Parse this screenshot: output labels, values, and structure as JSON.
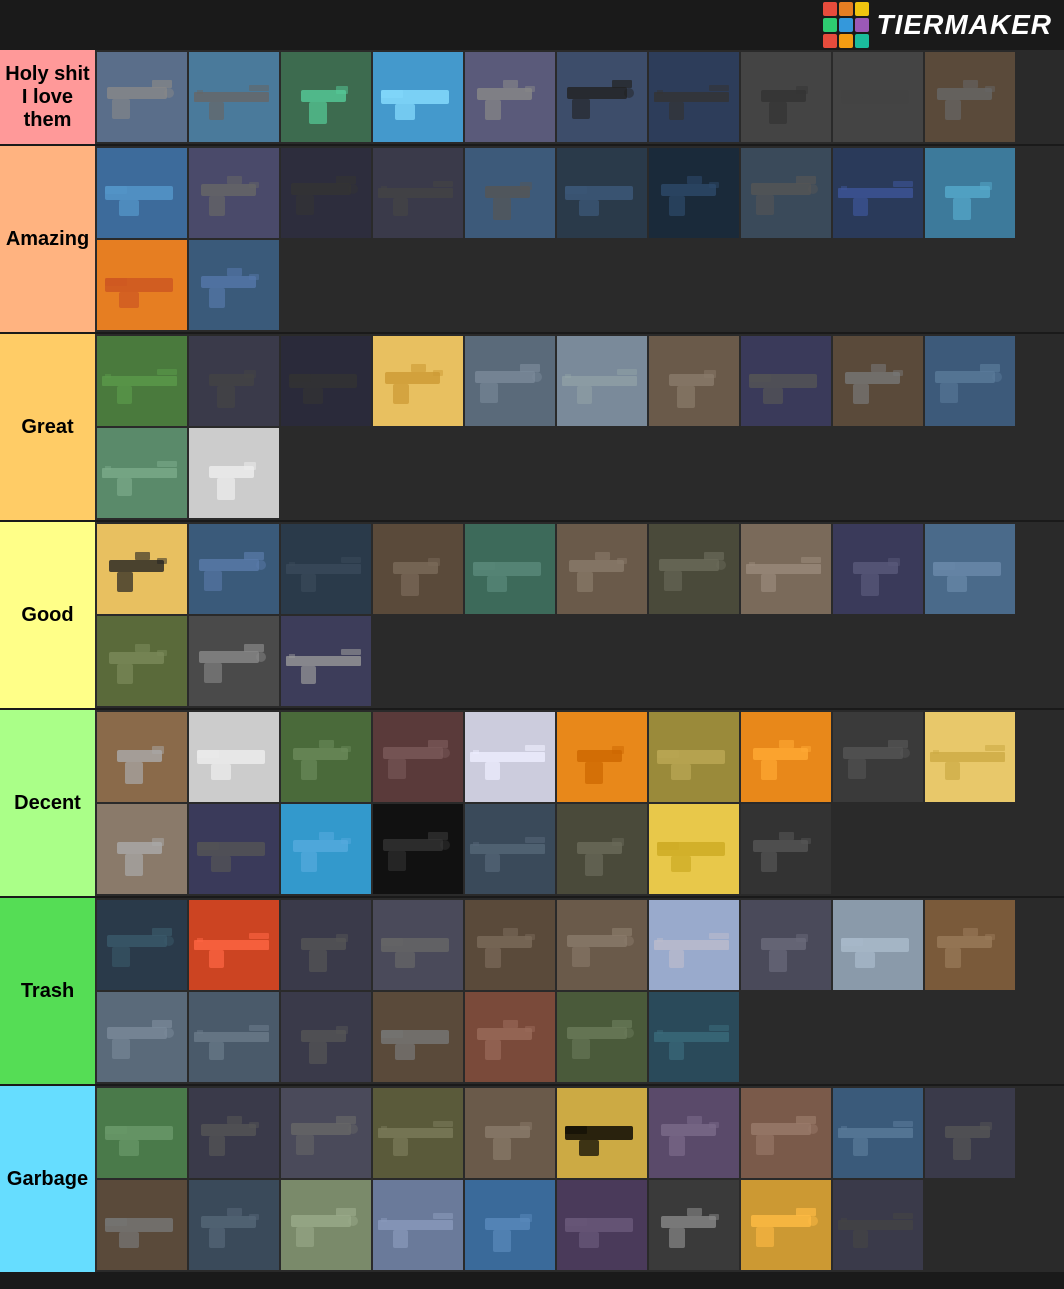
{
  "header": {
    "logo_colors": [
      "#e74c3c",
      "#e67e22",
      "#f1c40f",
      "#2ecc71",
      "#3498db",
      "#9b59b6",
      "#e74c3c",
      "#f39c12",
      "#1abc9c"
    ],
    "title": "TiERMAKER"
  },
  "tiers": [
    {
      "id": "holy-shit",
      "label": "Holy shit I love them",
      "color": "#ff9999",
      "items": [
        {
          "bg": "#5a6e8a",
          "accent": "#888"
        },
        {
          "bg": "#4a7a9b",
          "accent": "#666"
        },
        {
          "bg": "#3d6b4f",
          "accent": "#5c9"
        },
        {
          "bg": "#4499cc",
          "accent": "#88ddff"
        },
        {
          "bg": "#5a5a7a",
          "accent": "#888"
        },
        {
          "bg": "#3d4d6a",
          "accent": "#222"
        },
        {
          "bg": "#2d3d5a",
          "accent": "#333"
        },
        {
          "bg": "#444",
          "accent": "#333"
        },
        {
          "bg": "#444",
          "accent": "#444"
        },
        {
          "bg": "#5a4a3a",
          "accent": "#666"
        }
      ]
    },
    {
      "id": "amazing",
      "label": "Amazing",
      "color": "#ffb380",
      "items": [
        {
          "bg": "#3d6b9b",
          "accent": "#5599cc"
        },
        {
          "bg": "#4a4a6a",
          "accent": "#666"
        },
        {
          "bg": "#2d2d3d",
          "accent": "#333"
        },
        {
          "bg": "#3a3a4a",
          "accent": "#444"
        },
        {
          "bg": "#3d5a7a",
          "accent": "#555"
        },
        {
          "bg": "#2a3a4a",
          "accent": "#3d5a7a"
        },
        {
          "bg": "#1a2a3a",
          "accent": "#2d4a6a"
        },
        {
          "bg": "#3a4a5a",
          "accent": "#555"
        },
        {
          "bg": "#2a3a5a",
          "accent": "#3d5599"
        },
        {
          "bg": "#3d7a9b",
          "accent": "#55aacc"
        },
        {
          "bg": "#e67e22",
          "accent": "#cc5522"
        },
        {
          "bg": "#3a5a7a",
          "accent": "#5577aa"
        }
      ]
    },
    {
      "id": "great",
      "label": "Great",
      "color": "#ffcc66",
      "items": [
        {
          "bg": "#4a7a3d",
          "accent": "#5a9a4a"
        },
        {
          "bg": "#3a3a4a",
          "accent": "#444"
        },
        {
          "bg": "#2a2a3a",
          "accent": "#333"
        },
        {
          "bg": "#e8c060",
          "accent": "#cc9933"
        },
        {
          "bg": "#5a6a7a",
          "accent": "#7a8a9a"
        },
        {
          "bg": "#7a8a9a",
          "accent": "#9aaa"
        },
        {
          "bg": "#6a5a4a",
          "accent": "#8a7a6a"
        },
        {
          "bg": "#3a3a5a",
          "accent": "#555"
        },
        {
          "bg": "#5a4a3a",
          "accent": "#777"
        },
        {
          "bg": "#3d5a7a",
          "accent": "#5a7a9a"
        },
        {
          "bg": "#5a8a6a",
          "accent": "#7aaa8a"
        },
        {
          "bg": "#cccccc",
          "accent": "#eeeeee"
        }
      ]
    },
    {
      "id": "good",
      "label": "Good",
      "color": "#ffff88",
      "items": [
        {
          "bg": "#e8c060",
          "accent": "#222"
        },
        {
          "bg": "#3a5a7a",
          "accent": "#5a7aaa"
        },
        {
          "bg": "#2a3a4a",
          "accent": "#3a4a5a"
        },
        {
          "bg": "#5a4a3a",
          "accent": "#7a6a5a"
        },
        {
          "bg": "#3d6a5a",
          "accent": "#5a8a7a"
        },
        {
          "bg": "#6a5a4a",
          "accent": "#8a7a6a"
        },
        {
          "bg": "#4a4a3a",
          "accent": "#6a6a5a"
        },
        {
          "bg": "#7a6a5a",
          "accent": "#9a8a7a"
        },
        {
          "bg": "#3a3a5a",
          "accent": "#5a5a7a"
        },
        {
          "bg": "#4a6a8a",
          "accent": "#6a8aaa"
        },
        {
          "bg": "#5a6a3a",
          "accent": "#7a8a5a"
        },
        {
          "bg": "#4a4a4a",
          "accent": "#888"
        },
        {
          "bg": "#3d3d5a",
          "accent": "#999"
        }
      ]
    },
    {
      "id": "decent",
      "label": "Decent",
      "color": "#aaff88",
      "items": [
        {
          "bg": "#8a6a4a",
          "accent": "#aaa"
        },
        {
          "bg": "#cccccc",
          "accent": "#eeeeee"
        },
        {
          "bg": "#4a6a3a",
          "accent": "#6a8a5a"
        },
        {
          "bg": "#5a3a3a",
          "accent": "#7a5a5a"
        },
        {
          "bg": "#ccccdd",
          "accent": "#eeeeff"
        },
        {
          "bg": "#e8881a",
          "accent": "#cc6600"
        },
        {
          "bg": "#9a8a3a",
          "accent": "#bba855"
        },
        {
          "bg": "#e8881a",
          "accent": "#ffaa33"
        },
        {
          "bg": "#3a3a3a",
          "accent": "#555"
        },
        {
          "bg": "#e8c86a",
          "accent": "#ccaa44"
        },
        {
          "bg": "#8a7a6a",
          "accent": "#aaa"
        },
        {
          "bg": "#3a3a5a",
          "accent": "#555"
        },
        {
          "bg": "#3399cc",
          "accent": "#55aadd"
        },
        {
          "bg": "#111111",
          "accent": "#333"
        },
        {
          "bg": "#3a4a5a",
          "accent": "#556677"
        },
        {
          "bg": "#4a4a3a",
          "accent": "#6a6a5a"
        },
        {
          "bg": "#e8c84a",
          "accent": "#ccaa22"
        },
        {
          "bg": "#333",
          "accent": "#555"
        }
      ]
    },
    {
      "id": "trash",
      "label": "Trash",
      "color": "#55dd55",
      "items": [
        {
          "bg": "#2a3a4a",
          "accent": "#3a5a6a"
        },
        {
          "bg": "#cc4422",
          "accent": "#ff6644"
        },
        {
          "bg": "#3a3a4a",
          "accent": "#555"
        },
        {
          "bg": "#4a4a5a",
          "accent": "#666"
        },
        {
          "bg": "#5a4a3a",
          "accent": "#7a6a5a"
        },
        {
          "bg": "#6a5a4a",
          "accent": "#8a7a6a"
        },
        {
          "bg": "#99aacc",
          "accent": "#bbc"
        },
        {
          "bg": "#4a4a5a",
          "accent": "#6a6a7a"
        },
        {
          "bg": "#8a9aaa",
          "accent": "#aabbcc"
        },
        {
          "bg": "#7a5a3a",
          "accent": "#9a7a5a"
        },
        {
          "bg": "#5a6a7a",
          "accent": "#7a8a9a"
        },
        {
          "bg": "#4a5a6a",
          "accent": "#6a7a8a"
        },
        {
          "bg": "#3a3a4a",
          "accent": "#555"
        },
        {
          "bg": "#5a4a3a",
          "accent": "#777"
        },
        {
          "bg": "#7a4a3a",
          "accent": "#9a6a5a"
        },
        {
          "bg": "#4a5a3a",
          "accent": "#6a7a5a"
        },
        {
          "bg": "#2a4a5a",
          "accent": "#3a6a7a"
        }
      ]
    },
    {
      "id": "garbage",
      "label": "Garbage",
      "color": "#66ddff",
      "items": [
        {
          "bg": "#4a7a4a",
          "accent": "#6a9a6a"
        },
        {
          "bg": "#3a3a4a",
          "accent": "#555"
        },
        {
          "bg": "#4a4a5a",
          "accent": "#666"
        },
        {
          "bg": "#5a5a3a",
          "accent": "#7a7a5a"
        },
        {
          "bg": "#6a5a4a",
          "accent": "#8a7a6a"
        },
        {
          "bg": "#ccaa44",
          "accent": "#eecca"
        },
        {
          "bg": "#5a4a6a",
          "accent": "#7a6a8a"
        },
        {
          "bg": "#7a5a4a",
          "accent": "#9a7a6a"
        },
        {
          "bg": "#3a5a7a",
          "accent": "#5a7a9a"
        },
        {
          "bg": "#3a3a4a",
          "accent": "#555"
        },
        {
          "bg": "#5a4a3a",
          "accent": "#777"
        },
        {
          "bg": "#3a4a5a",
          "accent": "#556677"
        },
        {
          "bg": "#7a8a6a",
          "accent": "#9aaa8a"
        },
        {
          "bg": "#6a7a9a",
          "accent": "#8a9abb"
        },
        {
          "bg": "#3a6a9a",
          "accent": "#5a8abb"
        },
        {
          "bg": "#4a3a5a",
          "accent": "#6a5a7a"
        },
        {
          "bg": "#3a3a3a",
          "accent": "#888"
        },
        {
          "bg": "#cc9933",
          "accent": "#ffbb44"
        },
        {
          "bg": "#3a3a4a",
          "accent": "#444"
        }
      ]
    }
  ]
}
